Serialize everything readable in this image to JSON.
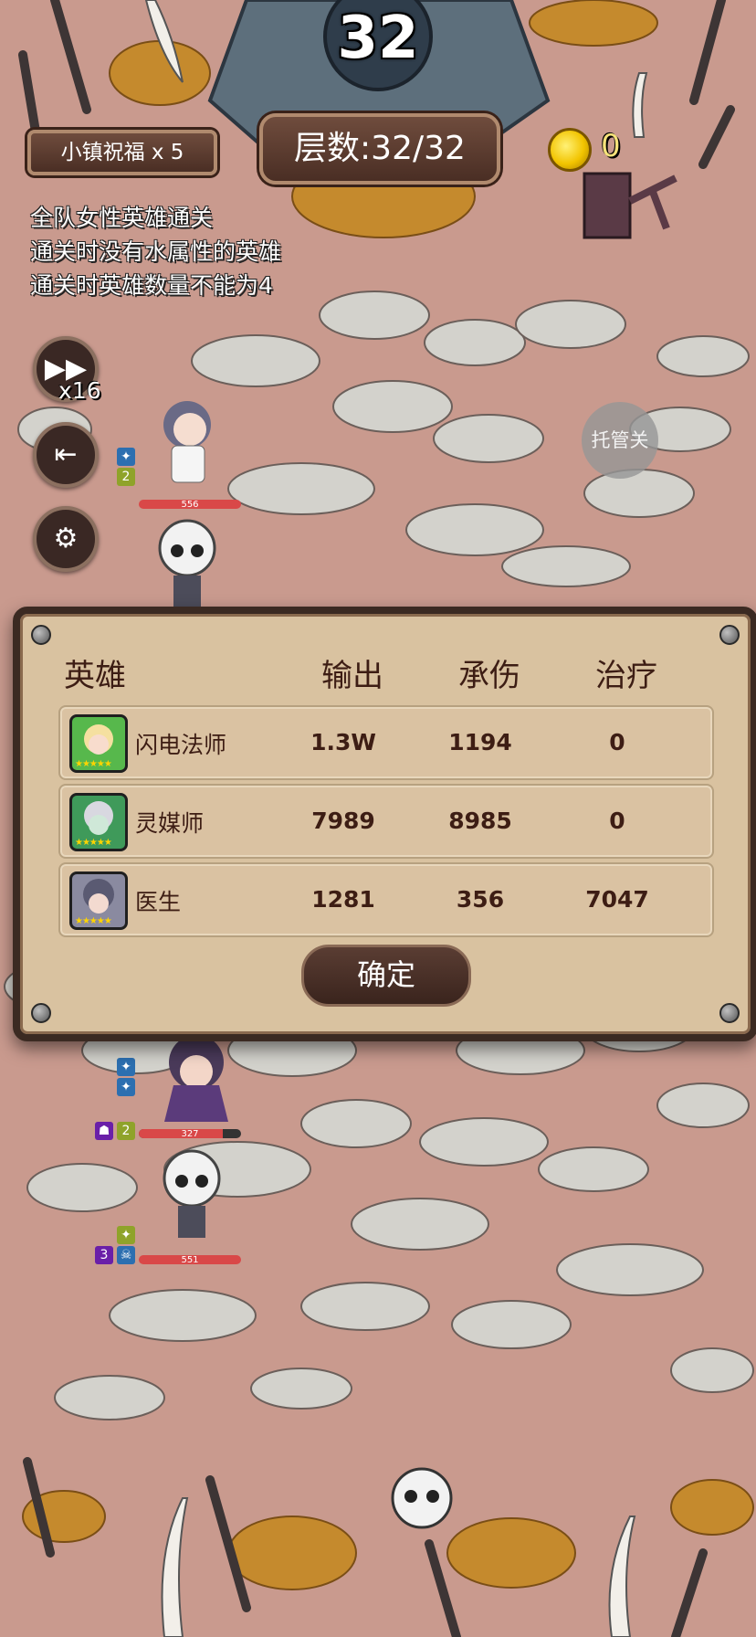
{
  "hud": {
    "round_number": "32",
    "blessing_label": "小镇祝福 x 5",
    "floor_label": "层数:32/32",
    "gold": "0",
    "speed_label": "x16",
    "auto_button": "托管关"
  },
  "rules": [
    "全队女性英雄通关",
    "通关时没有水属性的英雄",
    "通关时英雄数量不能为4"
  ],
  "field_units": [
    {
      "hp_value": "556",
      "hp_fraction": 1.0,
      "level_badge": "2"
    },
    {
      "hp_value": "327",
      "hp_fraction": 0.82,
      "level_badge": "2"
    },
    {
      "hp_value": "551",
      "hp_fraction": 1.0,
      "level_badge": "3"
    }
  ],
  "summary": {
    "headers": {
      "hero": "英雄",
      "damage": "输出",
      "taken": "承伤",
      "heal": "治疗"
    },
    "rows": [
      {
        "name": "闪电法师",
        "damage": "1.3W",
        "taken": "1194",
        "heal": "0"
      },
      {
        "name": "灵媒师",
        "damage": "7989",
        "taken": "8985",
        "heal": "0"
      },
      {
        "name": "医生",
        "damage": "1281",
        "taken": "356",
        "heal": "7047"
      }
    ],
    "confirm_label": "确定"
  },
  "colors": {
    "ground": "#c99a8e",
    "stone": "#d3d2cc",
    "panel": "#d9c2a0",
    "panel_text": "#3d1d14",
    "hp_bar": "#d94848"
  }
}
